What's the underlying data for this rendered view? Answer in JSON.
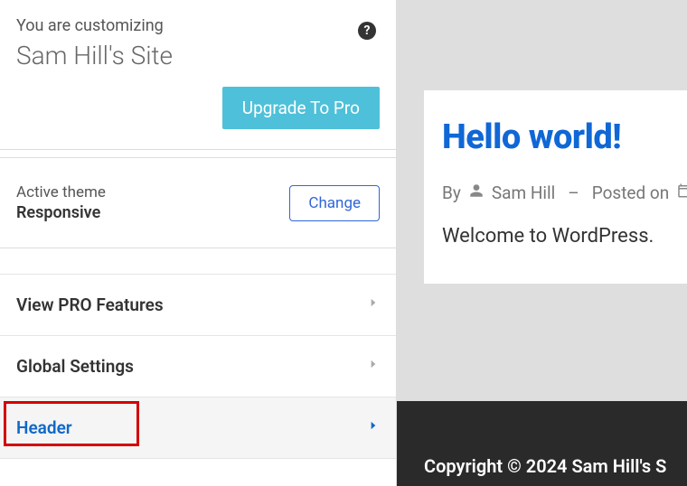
{
  "sidebar": {
    "customizing_label": "You are customizing",
    "site_title": "Sam Hill's Site",
    "help_tooltip": "?",
    "upgrade_label": "Upgrade To Pro",
    "theme": {
      "label": "Active theme",
      "name": "Responsive",
      "change_label": "Change"
    },
    "menu": [
      {
        "label": "View PRO Features",
        "highlighted": false
      },
      {
        "label": "Global Settings",
        "highlighted": false
      },
      {
        "label": "Header",
        "highlighted": true
      }
    ]
  },
  "preview": {
    "post_title": "Hello world!",
    "meta": {
      "by": "By",
      "author": "Sam Hill",
      "posted_on": "Posted on"
    },
    "content": "Welcome to WordPress.",
    "footer": "Copyright © 2024 Sam Hill's S"
  }
}
